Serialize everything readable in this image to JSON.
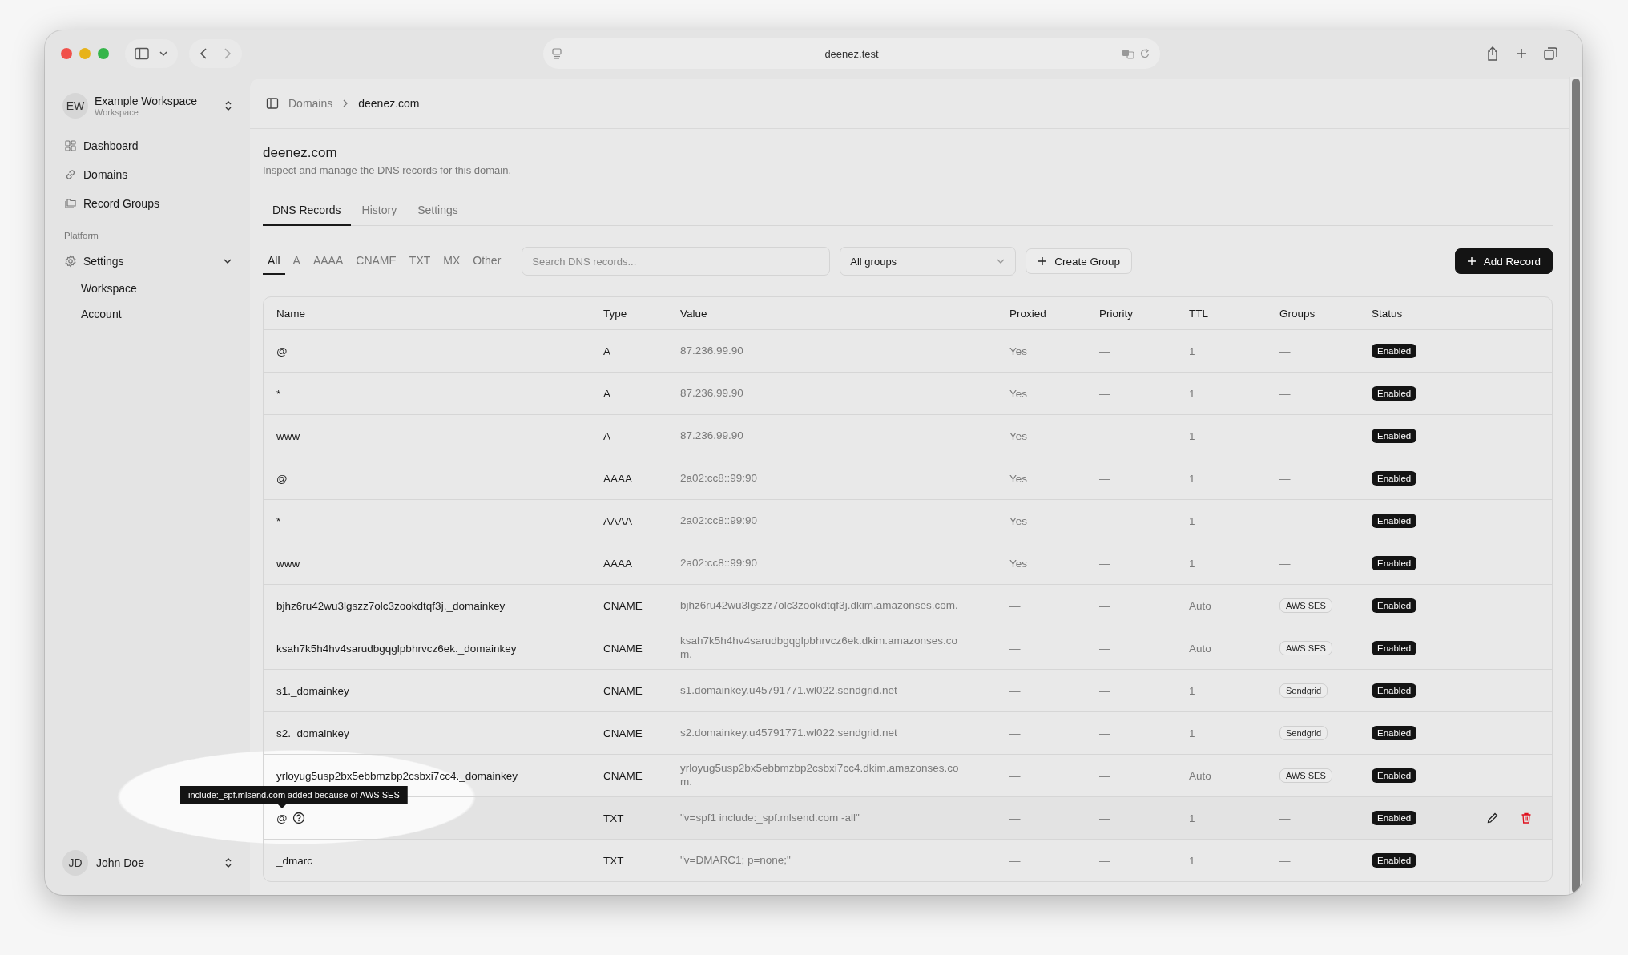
{
  "browser": {
    "url": "deenez.test"
  },
  "workspace": {
    "initials": "EW",
    "name": "Example Workspace",
    "subtitle": "Workspace"
  },
  "sidebar": {
    "items": [
      {
        "label": "Dashboard"
      },
      {
        "label": "Domains"
      },
      {
        "label": "Record Groups"
      }
    ],
    "section": {
      "label": "Platform",
      "items": [
        {
          "label": "Settings",
          "expanded": true,
          "children": [
            {
              "label": "Workspace"
            },
            {
              "label": "Account"
            }
          ]
        }
      ]
    }
  },
  "user": {
    "initials": "JD",
    "name": "John Doe"
  },
  "breadcrumb": [
    "Domains",
    "deenez.com"
  ],
  "title": "deenez.com",
  "description": "Inspect and manage the DNS records for this domain.",
  "tabs": [
    {
      "label": "DNS Records",
      "selected": true
    },
    {
      "label": "History",
      "selected": false
    },
    {
      "label": "Settings",
      "selected": false
    }
  ],
  "filters": [
    {
      "label": "All",
      "selected": true
    },
    {
      "label": "A",
      "selected": false
    },
    {
      "label": "AAAA",
      "selected": false
    },
    {
      "label": "CNAME",
      "selected": false
    },
    {
      "label": "TXT",
      "selected": false
    },
    {
      "label": "MX",
      "selected": false
    },
    {
      "label": "Other",
      "selected": false
    }
  ],
  "search": {
    "placeholder": "Search DNS records..."
  },
  "group_select": {
    "value": "All groups"
  },
  "create_group": "Create Group",
  "add_record": "Add Record",
  "table": {
    "columns": [
      "Name",
      "Type",
      "Value",
      "Proxied",
      "Priority",
      "TTL",
      "Groups",
      "Status"
    ],
    "rows": [
      {
        "name": "@",
        "type": "A",
        "value": "87.236.99.90",
        "proxied": "Yes",
        "priority": "—",
        "ttl": "1",
        "groups": "—",
        "groups_tag": false,
        "status": "Enabled",
        "hovered": false,
        "hint": false
      },
      {
        "name": "*",
        "type": "A",
        "value": "87.236.99.90",
        "proxied": "Yes",
        "priority": "—",
        "ttl": "1",
        "groups": "—",
        "groups_tag": false,
        "status": "Enabled",
        "hovered": false,
        "hint": false
      },
      {
        "name": "www",
        "type": "A",
        "value": "87.236.99.90",
        "proxied": "Yes",
        "priority": "—",
        "ttl": "1",
        "groups": "—",
        "groups_tag": false,
        "status": "Enabled",
        "hovered": false,
        "hint": false
      },
      {
        "name": "@",
        "type": "AAAA",
        "value": "2a02:cc8::99:90",
        "proxied": "Yes",
        "priority": "—",
        "ttl": "1",
        "groups": "—",
        "groups_tag": false,
        "status": "Enabled",
        "hovered": false,
        "hint": false
      },
      {
        "name": "*",
        "type": "AAAA",
        "value": "2a02:cc8::99:90",
        "proxied": "Yes",
        "priority": "—",
        "ttl": "1",
        "groups": "—",
        "groups_tag": false,
        "status": "Enabled",
        "hovered": false,
        "hint": false
      },
      {
        "name": "www",
        "type": "AAAA",
        "value": "2a02:cc8::99:90",
        "proxied": "Yes",
        "priority": "—",
        "ttl": "1",
        "groups": "—",
        "groups_tag": false,
        "status": "Enabled",
        "hovered": false,
        "hint": false
      },
      {
        "name": "bjhz6ru42wu3lgszz7olc3zookdtqf3j._domainkey",
        "type": "CNAME",
        "value": "bjhz6ru42wu3lgszz7olc3zookdtqf3j.dkim.amazonses.com.",
        "proxied": "—",
        "priority": "—",
        "ttl": "Auto",
        "groups": "AWS SES",
        "groups_tag": true,
        "status": "Enabled",
        "hovered": false,
        "hint": false
      },
      {
        "name": "ksah7k5h4hv4sarudbgqglpbhrvcz6ek._domainkey",
        "type": "CNAME",
        "value": "ksah7k5h4hv4sarudbgqglpbhrvcz6ek.dkim.amazonses.com.",
        "proxied": "—",
        "priority": "—",
        "ttl": "Auto",
        "groups": "AWS SES",
        "groups_tag": true,
        "status": "Enabled",
        "hovered": false,
        "hint": false
      },
      {
        "name": "s1._domainkey",
        "type": "CNAME",
        "value": "s1.domainkey.u45791771.wl022.sendgrid.net",
        "proxied": "—",
        "priority": "—",
        "ttl": "1",
        "groups": "Sendgrid",
        "groups_tag": true,
        "status": "Enabled",
        "hovered": false,
        "hint": false
      },
      {
        "name": "s2._domainkey",
        "type": "CNAME",
        "value": "s2.domainkey.u45791771.wl022.sendgrid.net",
        "proxied": "—",
        "priority": "—",
        "ttl": "1",
        "groups": "Sendgrid",
        "groups_tag": true,
        "status": "Enabled",
        "hovered": false,
        "hint": false
      },
      {
        "name": "yrloyug5usp2bx5ebbmzbp2csbxi7cc4._domainkey",
        "type": "CNAME",
        "value": "yrloyug5usp2bx5ebbmzbp2csbxi7cc4.dkim.amazonses.com.",
        "proxied": "—",
        "priority": "—",
        "ttl": "Auto",
        "groups": "AWS SES",
        "groups_tag": true,
        "status": "Enabled",
        "hovered": false,
        "hint": false
      },
      {
        "name": "@",
        "type": "TXT",
        "value": "\"v=spf1 include:_spf.mlsend.com -all\"",
        "proxied": "—",
        "priority": "—",
        "ttl": "1",
        "groups": "—",
        "groups_tag": false,
        "status": "Enabled",
        "hovered": true,
        "hint": true
      },
      {
        "name": "_dmarc",
        "type": "TXT",
        "value": "\"v=DMARC1; p=none;\"",
        "proxied": "—",
        "priority": "—",
        "ttl": "1",
        "groups": "—",
        "groups_tag": false,
        "status": "Enabled",
        "hovered": false,
        "hint": false
      }
    ]
  },
  "tooltip": {
    "text": "include:_spf.mlsend.com added because of AWS SES"
  }
}
